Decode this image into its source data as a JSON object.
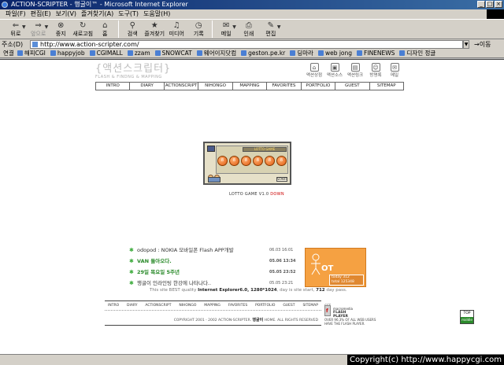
{
  "window": {
    "title": "ACTION-SCRIPTER - 행굴이™ - Microsoft Internet Explorer",
    "controls": [
      "_",
      "□",
      "×"
    ]
  },
  "menubar": [
    "파일(F)",
    "편집(E)",
    "보기(V)",
    "즐겨찾기(A)",
    "도구(T)",
    "도움말(H)"
  ],
  "toolbar": {
    "back": "뒤로",
    "forward": "앞으로",
    "stop": "중지",
    "refresh": "새로고침",
    "home": "홈",
    "search": "검색",
    "favorites": "즐겨찾기",
    "media": "미디어",
    "history": "기록",
    "mail": "메일",
    "print": "인쇄",
    "edit": "편집"
  },
  "address": {
    "label": "주소(D)",
    "url": "http://www.action-scripter.com/",
    "go": "이동"
  },
  "links": {
    "label": "연결",
    "items": [
      "해피CGI",
      "happyjob",
      "CGIMALL",
      "zzam",
      "SNOWCAT",
      "웨어이지닷컴",
      "geston.pe.kr",
      "딩마라",
      "web jong",
      "FINENEWS",
      "디자인 정글"
    ]
  },
  "site": {
    "logo": "{액션스크립터}",
    "logo_sub": "FLASH & FINDNG & MAPPING",
    "quick_links": [
      {
        "label": "액션상점",
        "icon": "house-icon"
      },
      {
        "label": "액션소스",
        "icon": "disk-icon"
      },
      {
        "label": "액션링크",
        "icon": "link-icon"
      },
      {
        "label": "방명록",
        "icon": "book-icon"
      },
      {
        "label": "메일",
        "icon": "mail-icon"
      }
    ],
    "nav": [
      "INTRO",
      "DIARY",
      "ACTIONSCRIPT",
      "NIHONGO",
      "MAPPING",
      "FAVORITES",
      "PORTFOLIO",
      "GUEST",
      "SITEMAP"
    ],
    "lotto": {
      "banner": "LOTTO GAME",
      "balls": [
        "8",
        "8",
        "8",
        "8",
        "8",
        "8"
      ],
      "start": "START",
      "caption_main": "LOTTO GAME V1.0",
      "caption_accent": "DOWN"
    },
    "news": [
      {
        "text": "odopod : NOKIA 모바일폰 Flash APP개발",
        "date": "06.03 16:01",
        "highlight": false
      },
      {
        "text": "VAN 돌아오다.",
        "date": "05.06 13:34",
        "highlight": true
      },
      {
        "text": "29일 목요일 5주년",
        "date": "05.05 23:52",
        "highlight": true
      },
      {
        "text": "행굴이 인라인팅 한강에 나타나다..",
        "date": "05.05 23:21",
        "highlight": false
      }
    ],
    "promo": {
      "text": "OT",
      "stat_lines": [
        "today   312",
        "total 125348"
      ]
    },
    "best_view": {
      "prefix": "This site BEST quality",
      "browser": "Internet Explorer6.0, 1280*1024",
      "middle": ", day is site start,",
      "days": "712",
      "suffix": "day pass."
    },
    "footer": {
      "nav": [
        "INTRO",
        "DIARY",
        "ACTIONSCRIPT",
        "NIHONGO",
        "MAPPING",
        "FAVORITES",
        "PORTFOLIO",
        "GUEST",
        "SITEMAP"
      ],
      "copyright_prefix": "COPYRIGHT 2001 - 2002 ACTION-SCRIPTER.",
      "brand": "행굴이",
      "copyright_suffix": "HOME. ALL RIGHTS RESERVED"
    },
    "macromedia": {
      "head": "GET",
      "line1": "macromedia",
      "line2": "FLASH",
      "line3": "PLAYER",
      "desc1": "OVER 96.3% OF ALL WEB USERS",
      "desc2": "HAVE THE FLASH PLAYER."
    },
    "top_button": {
      "top": "TOP",
      "middle": "middle"
    }
  },
  "watermark": "Copyright(c) http://www.happycgi.com"
}
